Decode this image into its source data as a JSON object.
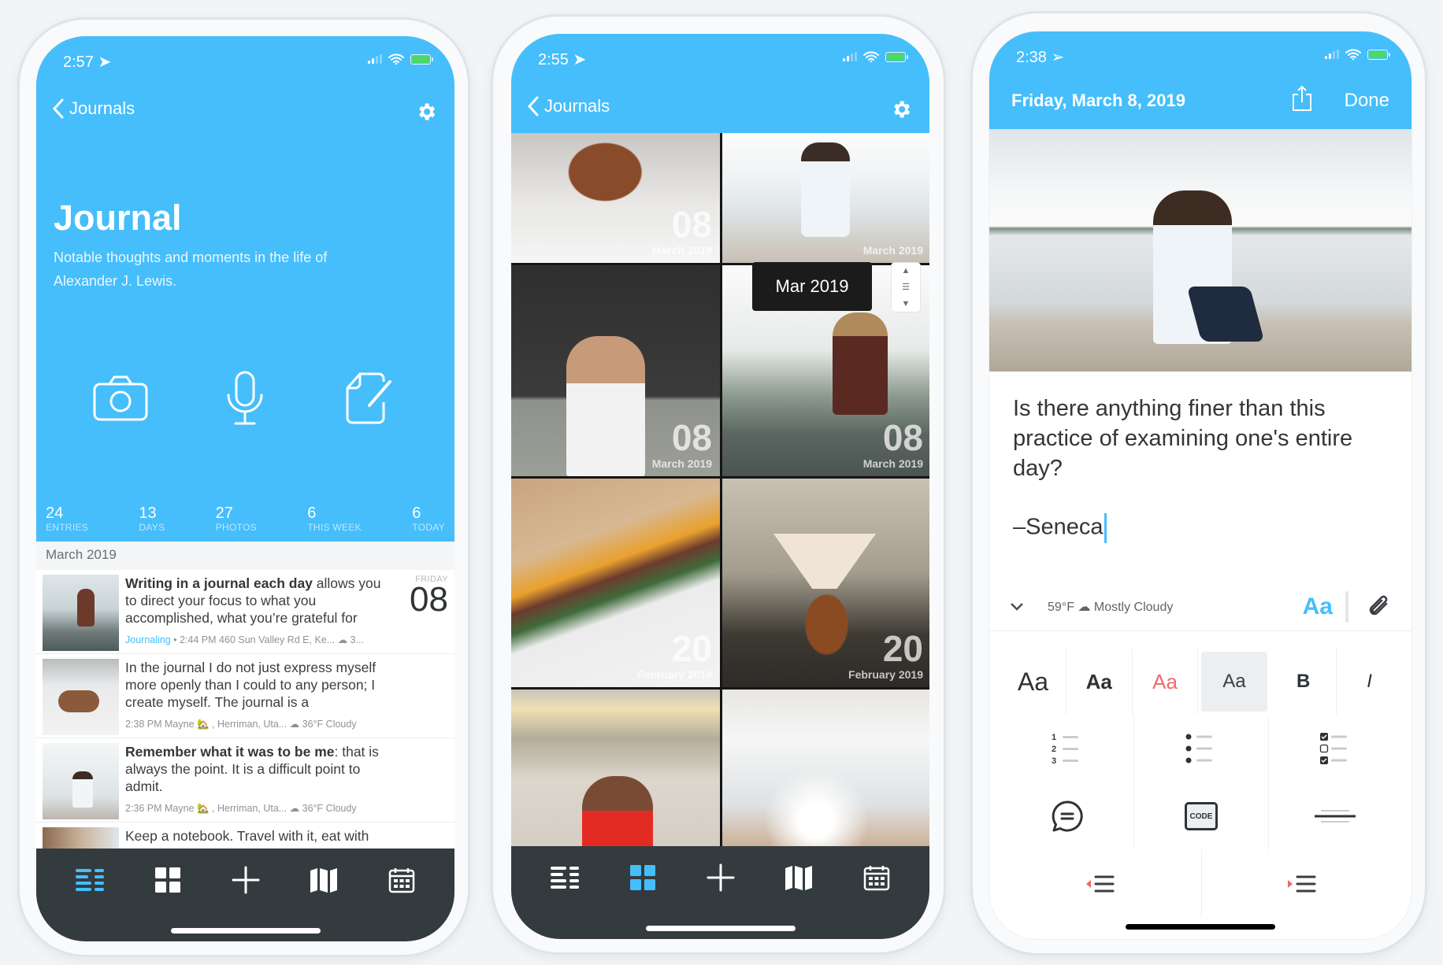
{
  "theme": {
    "accent": "#45befb",
    "tabbar": "#343b3f",
    "highlight_red": "#ef6a6a"
  },
  "phones": {
    "journal": {
      "status": {
        "time": "2:57"
      },
      "nav": {
        "back_label": "Journals"
      },
      "title": "Journal",
      "subtitle": "Notable thoughts and moments in the life of Alexander J. Lewis.",
      "actions": [
        "camera-icon",
        "microphone-icon",
        "new-entry-icon"
      ],
      "stats": [
        {
          "value": "24",
          "label": "ENTRIES"
        },
        {
          "value": "13",
          "label": "DAYS"
        },
        {
          "value": "27",
          "label": "PHOTOS"
        },
        {
          "value": "6",
          "label": "THIS WEEK"
        },
        {
          "value": "6",
          "label": "TODAY"
        }
      ],
      "section": "March 2019",
      "entries": [
        {
          "bold": "Writing in a journal each day",
          "text": " allows you to direct your focus to what you accomplished, what you’re grateful for",
          "tag": "Journaling",
          "meta": " • 2:44 PM 460 Sun Valley Rd E, Ke... ☁ 3...",
          "day_name": "FRIDAY",
          "day_num": "08"
        },
        {
          "bold": "",
          "text": "In the journal I do not just express myself more openly than I could to any person; I create myself. The journal is a",
          "tag": "",
          "meta": "2:38 PM Mayne 🏡 , Herriman, Uta... ☁ 36°F Cloudy",
          "day_name": "",
          "day_num": ""
        },
        {
          "bold": "Remember what it was to be me",
          "text": ": that is always the point. It is a difficult point to admit.",
          "tag": "",
          "meta": "2:36 PM Mayne 🏡 , Herriman, Uta... ☁ 36°F Cloudy",
          "day_name": "",
          "day_num": ""
        },
        {
          "bold": "",
          "text": "Keep a notebook. Travel with it, eat with",
          "tag": "",
          "meta": "",
          "day_name": "",
          "day_num": ""
        }
      ],
      "tabs": [
        "list-view",
        "grid-view",
        "add",
        "map-view",
        "calendar-view"
      ],
      "active_tab": "list-view"
    },
    "media": {
      "status": {
        "time": "2:55"
      },
      "nav": {
        "back_label": "Journals"
      },
      "cells": [
        {
          "photo": "dog on blanket",
          "day": "08",
          "month": "March 2019"
        },
        {
          "photo": "man sitting by lake",
          "day": "",
          "month": "March 2019"
        },
        {
          "photo": "man with coffee in front of map",
          "day": "08",
          "month": "March 2019"
        },
        {
          "photo": "woman sitting on rock",
          "day": "08",
          "month": "March 2019"
        },
        {
          "photo": "sandwich",
          "day": "20",
          "month": "February 2019"
        },
        {
          "photo": "pour-over coffee",
          "day": "20",
          "month": "February 2019"
        },
        {
          "photo": "kids running",
          "day": "",
          "month": ""
        },
        {
          "photo": "bright window",
          "day": "",
          "month": ""
        }
      ],
      "scroll_tooltip": "Mar 2019",
      "active_tab": "grid-view"
    },
    "editor": {
      "status": {
        "time": "2:38"
      },
      "date": "Friday, March 8, 2019",
      "done_label": "Done",
      "body": "Is there anything finer than this practice of examining one's entire day?",
      "signature": "–Seneca",
      "weather": "59°F ☁ Mostly Cloudy",
      "style_button": "Aa",
      "format_row1": [
        "Aa",
        "Aa",
        "Aa",
        "Aa",
        "B",
        "I"
      ],
      "format_row2": [
        "numbered-list",
        "bulleted-list",
        "checklist"
      ],
      "format_row3": [
        "quote",
        "CODE",
        "horizontal-rule"
      ],
      "format_row4": [
        "outdent",
        "indent"
      ],
      "selected_style_index": 3
    }
  }
}
